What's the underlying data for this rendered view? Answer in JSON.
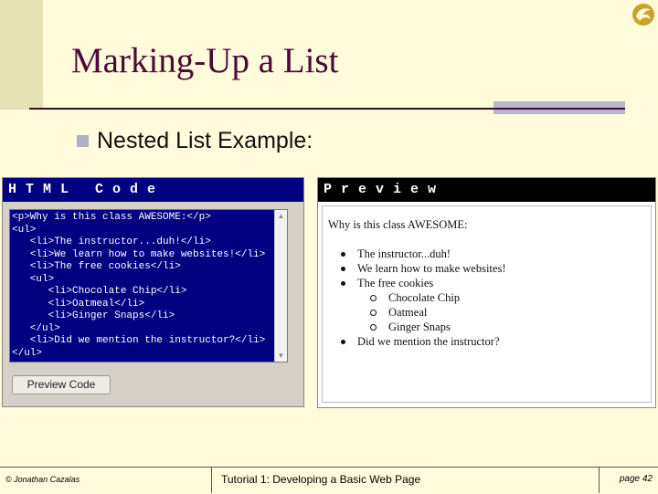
{
  "slide": {
    "title": "Marking-Up a List",
    "bullet": "Nested List Example:"
  },
  "html_panel": {
    "header": "HTML Code",
    "code_lines": [
      "<p>Why is this class AWESOME:</p>",
      "<ul>",
      "   <li>The instructor...duh!</li>",
      "   <li>We learn how to make websites!</li>",
      "   <li>The free cookies</li>",
      "   <ul>",
      "      <li>Chocolate Chip</li>",
      "      <li>Oatmeal</li>",
      "      <li>Ginger Snaps</li>",
      "   </ul>",
      "   <li>Did we mention the instructor?</li>",
      "</ul>"
    ],
    "button_label": "Preview Code"
  },
  "preview_panel": {
    "header": "Preview",
    "paragraph": "Why is this class AWESOME:",
    "items": [
      {
        "text": "The instructor...duh!",
        "level": 1
      },
      {
        "text": "We learn how to make websites!",
        "level": 1
      },
      {
        "text": "The free cookies",
        "level": 1
      },
      {
        "text": "Chocolate Chip",
        "level": 2
      },
      {
        "text": "Oatmeal",
        "level": 2
      },
      {
        "text": "Ginger Snaps",
        "level": 2
      },
      {
        "text": "Did we mention the instructor?",
        "level": 1
      }
    ]
  },
  "footer": {
    "author": "© Jonathan Cazalas",
    "course": "Tutorial 1:  Developing a Basic Web Page",
    "page": "page 42"
  },
  "colors": {
    "title": "#4b0a34",
    "html_header": "#000080",
    "code_bg": "#000080",
    "preview_header": "#000000"
  },
  "icons": [
    "ucf-pegasus-logo-icon",
    "square-bullet-icon",
    "scroll-up-icon",
    "scroll-down-icon"
  ]
}
